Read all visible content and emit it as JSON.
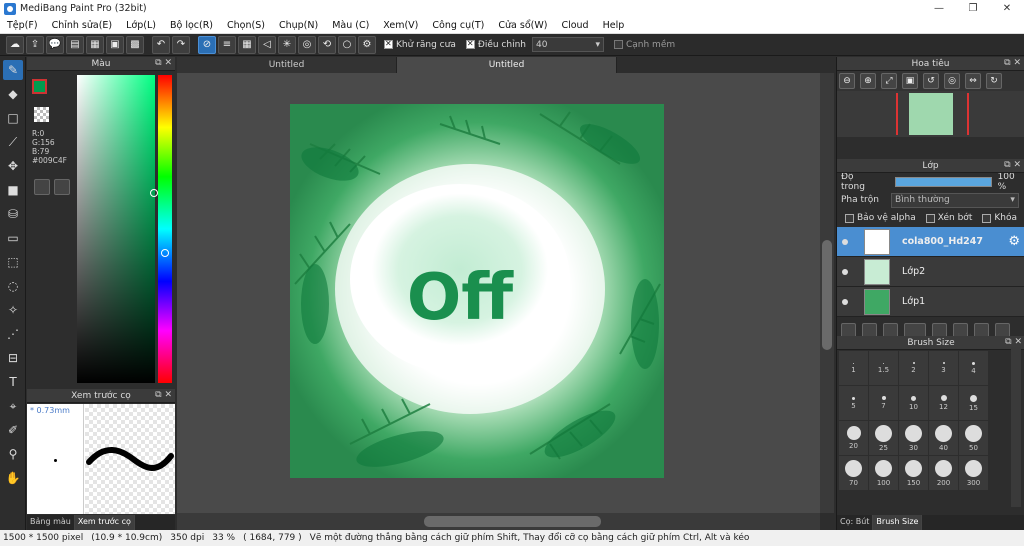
{
  "window": {
    "title": "MediBang Paint Pro (32bit)",
    "controls": {
      "minimize": "—",
      "maximize": "❐",
      "close": "✕"
    }
  },
  "menu": [
    "Tệp(F)",
    "Chỉnh sửa(E)",
    "Lớp(L)",
    "Bộ lọc(R)",
    "Chọn(S)",
    "Chụp(N)",
    "Màu (C)",
    "Xem(V)",
    "Công cụ(T)",
    "Cửa sổ(W)",
    "Cloud",
    "Help"
  ],
  "toolbar": {
    "antialias_label": "Khử răng cưa",
    "adjust_label": "Điều chỉnh",
    "adjust_value": "40",
    "sharp_label": "Cạnh mềm"
  },
  "color_panel": {
    "title": "Màu",
    "fg_color": "#009C4F",
    "r": "R:0",
    "g": "G:156",
    "b": "B:79",
    "hex": "#009C4F"
  },
  "brush_preview": {
    "title": "Xem trước cọ",
    "size": "* 0.73mm",
    "tabs": [
      "Bảng màu",
      "Xem trước cọ"
    ]
  },
  "document_tabs": [
    "Untitled",
    "Untitled"
  ],
  "artwork": {
    "text": "Off",
    "text_color": "#1a8f4e"
  },
  "navigator": {
    "title": "Hoa tiêu"
  },
  "layers": {
    "title": "Lớp",
    "opacity_label": "Độ trong",
    "opacity_value": "100 %",
    "blend_label": "Pha trộn",
    "blend_value": "Bình thường",
    "protect_alpha": "Bảo vệ alpha",
    "clipping": "Xén bớt",
    "lock": "Khóa",
    "items": [
      {
        "name": "cola800_Hd247",
        "selected": true
      },
      {
        "name": "Lớp2",
        "selected": false
      },
      {
        "name": "Lớp1",
        "selected": false
      }
    ]
  },
  "brush_size": {
    "title": "Brush Size",
    "sizes": [
      "1",
      "1.5",
      "2",
      "3",
      "4",
      "5",
      "7",
      "10",
      "12",
      "15",
      "20",
      "25",
      "30",
      "40",
      "50",
      "70",
      "100",
      "150",
      "200",
      "300"
    ],
    "tabs": [
      "Cọ: Bút",
      "Brush Size"
    ]
  },
  "status": {
    "pixels": "1500 * 1500 pixel",
    "size_cm": "(10.9 * 10.9cm)",
    "dpi": "350 dpi",
    "zoom": "33 %",
    "coords": "( 1684, 779 )",
    "hint": "Vẽ một đường thẳng bằng cách giữ phím Shift, Thay đổi cỡ cọ bằng cách giữ phím Ctrl, Alt và kéo"
  }
}
